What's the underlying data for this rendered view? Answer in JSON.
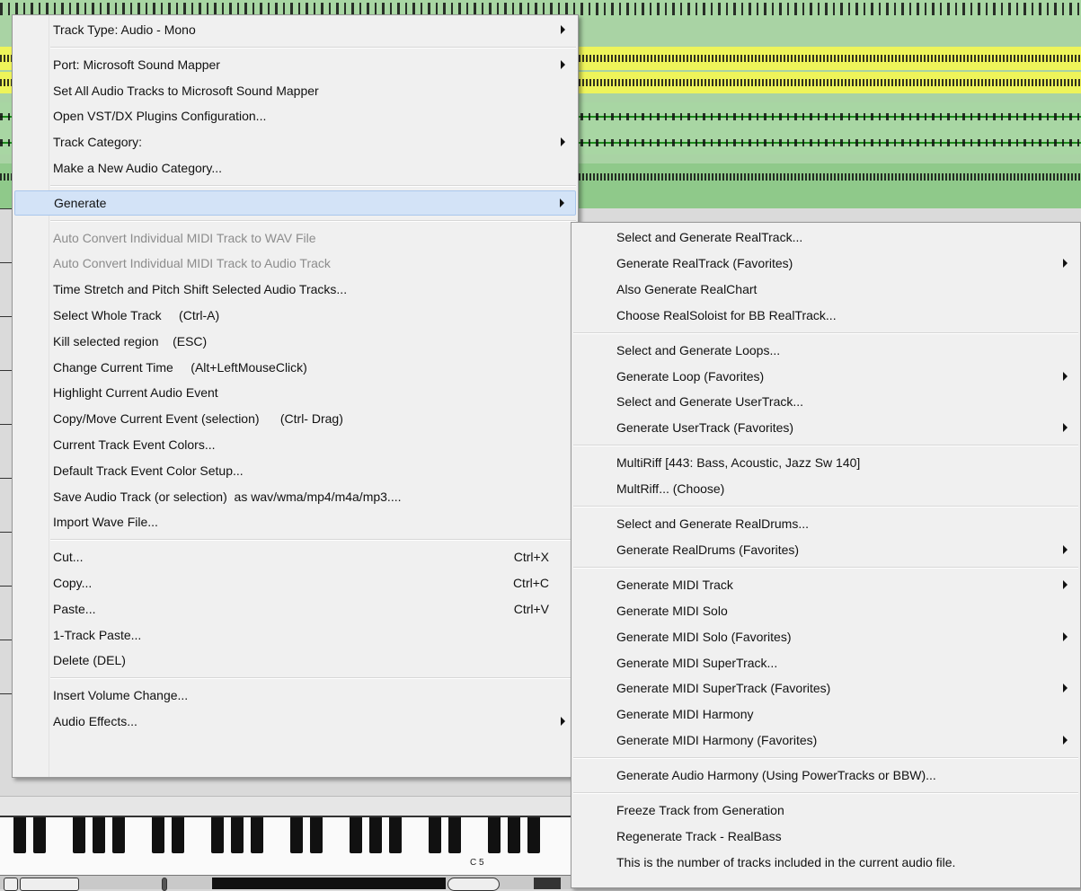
{
  "main_menu": {
    "items": [
      {
        "label": "Track Type: Audio - Mono",
        "submenu": true
      },
      {
        "sep": true
      },
      {
        "label": "Port: Microsoft Sound Mapper",
        "submenu": true
      },
      {
        "label": "Set All Audio Tracks to Microsoft Sound Mapper"
      },
      {
        "label": "Open VST/DX Plugins Configuration..."
      },
      {
        "label": "Track Category:",
        "submenu": true
      },
      {
        "label": "Make a New Audio Category..."
      },
      {
        "sep": true
      },
      {
        "label": "Generate",
        "submenu": true,
        "highlighted": true
      },
      {
        "sep": true
      },
      {
        "label": "Auto Convert Individual MIDI Track to WAV File",
        "disabled": true
      },
      {
        "label": "Auto Convert Individual MIDI Track to Audio Track",
        "disabled": true
      },
      {
        "label": "Time Stretch and Pitch Shift Selected Audio Tracks..."
      },
      {
        "label": "Select Whole Track     (Ctrl-A)"
      },
      {
        "label": "Kill selected region    (ESC)"
      },
      {
        "label": "Change Current Time     (Alt+LeftMouseClick)"
      },
      {
        "label": "Highlight Current Audio Event"
      },
      {
        "label": "Copy/Move Current Event (selection)      (Ctrl- Drag)"
      },
      {
        "label": "Current Track Event Colors..."
      },
      {
        "label": "Default Track Event Color Setup..."
      },
      {
        "label": "Save Audio Track (or selection)  as wav/wma/mp4/m4a/mp3...."
      },
      {
        "label": "Import Wave File..."
      },
      {
        "sep": true
      },
      {
        "label": "Cut...",
        "shortcut": "Ctrl+X"
      },
      {
        "label": "Copy...",
        "shortcut": "Ctrl+C"
      },
      {
        "label": "Paste...",
        "shortcut": "Ctrl+V"
      },
      {
        "label": "1-Track Paste..."
      },
      {
        "label": "Delete (DEL)"
      },
      {
        "sep": true
      },
      {
        "label": "Insert Volume Change..."
      },
      {
        "label": "Audio Effects...",
        "submenu": true
      }
    ]
  },
  "generate_submenu": {
    "items": [
      {
        "label": "Select and Generate RealTrack..."
      },
      {
        "label": "Generate RealTrack (Favorites)",
        "submenu": true
      },
      {
        "label": "Also Generate RealChart"
      },
      {
        "label": "Choose RealSoloist for BB RealTrack..."
      },
      {
        "sep": true
      },
      {
        "label": "Select and Generate Loops..."
      },
      {
        "label": "Generate Loop (Favorites)",
        "submenu": true
      },
      {
        "label": "Select and Generate UserTrack..."
      },
      {
        "label": "Generate UserTrack (Favorites)",
        "submenu": true
      },
      {
        "sep": true
      },
      {
        "label": "MultiRiff [443: Bass, Acoustic, Jazz Sw 140]"
      },
      {
        "label": "MultRiff... (Choose)"
      },
      {
        "sep": true
      },
      {
        "label": "Select and Generate RealDrums..."
      },
      {
        "label": "Generate RealDrums (Favorites)",
        "submenu": true
      },
      {
        "sep": true
      },
      {
        "label": "Generate MIDI Track",
        "submenu": true
      },
      {
        "label": "Generate MIDI Solo"
      },
      {
        "label": "Generate MIDI Solo (Favorites)",
        "submenu": true
      },
      {
        "label": "Generate MIDI SuperTrack..."
      },
      {
        "label": "Generate MIDI SuperTrack (Favorites)",
        "submenu": true
      },
      {
        "label": "Generate MIDI Harmony"
      },
      {
        "label": "Generate MIDI Harmony (Favorites)",
        "submenu": true
      },
      {
        "sep": true
      },
      {
        "label": "Generate Audio Harmony (Using PowerTracks or BBW)..."
      },
      {
        "sep": true
      },
      {
        "label": "Freeze Track from Generation"
      },
      {
        "label": "Regenerate Track - RealBass"
      },
      {
        "label": "This is the number of tracks included in the current audio file."
      }
    ]
  },
  "piano": {
    "octave_label": "C 5"
  },
  "colors": {
    "highlight": "#d3e3f7",
    "menu_bg": "#f0f0f0",
    "lane_yellow": "#eef45a",
    "lane_green": "#a8d6a3"
  }
}
